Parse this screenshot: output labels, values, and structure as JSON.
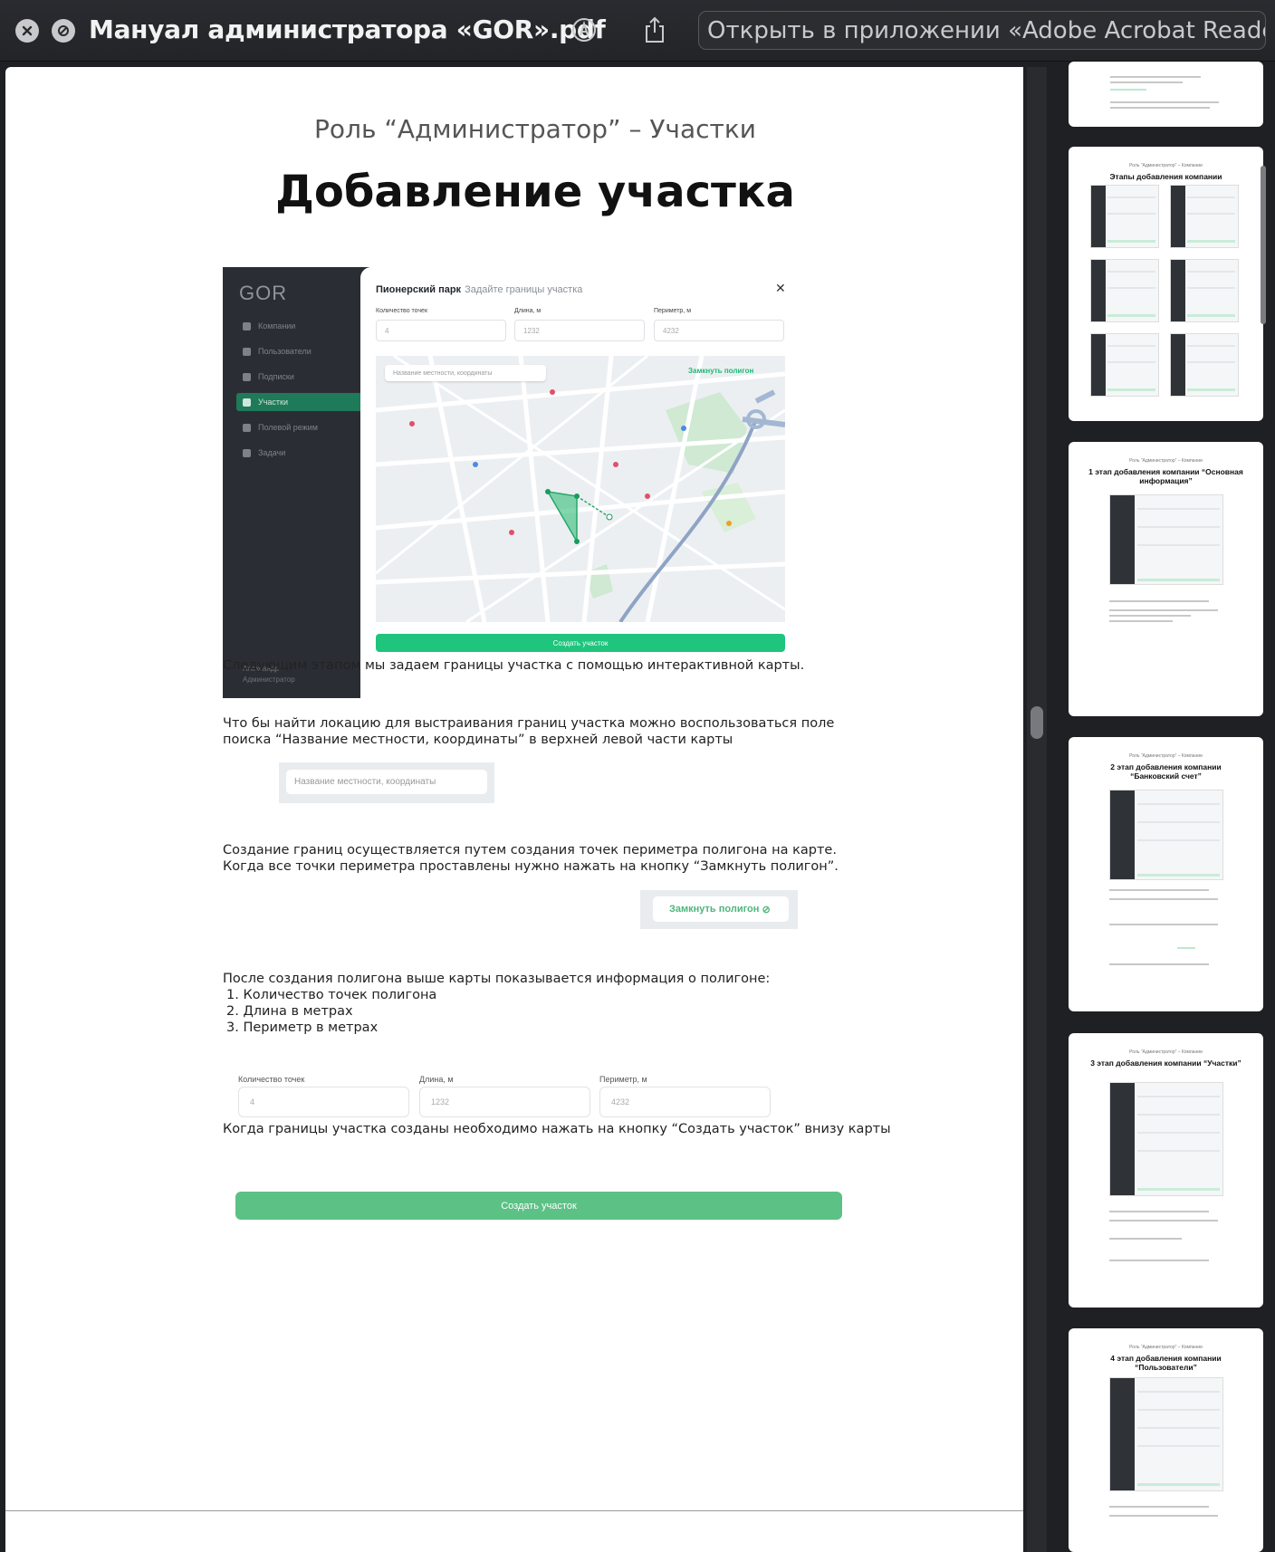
{
  "topbar": {
    "title": "Мануал администратора «GOR».pdf",
    "open_in_app": "Открыть в приложении «Adobe Acrobat Reader»",
    "icons": [
      "close-icon",
      "no-entry-icon",
      "markup-icon",
      "share-icon"
    ]
  },
  "doc": {
    "subtitle": "Роль “Администратор” – Участки",
    "title": "Добавление участка",
    "app": {
      "logo": "GOR",
      "menu": [
        "Компании",
        "Пользователи",
        "Подписки",
        "Участки",
        "Полевой режим",
        "Задачи"
      ],
      "active_menu": "Участки",
      "user_name": "Александр",
      "user_role": "Администратор",
      "dialog_title": "Пионерский парк",
      "dialog_subtitle": "Задайте границы участка",
      "fields": [
        {
          "label": "Количество точек",
          "value": "4"
        },
        {
          "label": "Длина, м",
          "value": "1232"
        },
        {
          "label": "Периметр, м",
          "value": "4232"
        }
      ],
      "map_search_placeholder": "Название местности, координаты",
      "close_polygon": "Замкнуть полигон",
      "create_button": "Создать участок"
    },
    "p1": "Следующим этапом мы задаем границы участка с помощью интерактивной карты.",
    "p2": "Что бы найти локацию для выстраивания границ участка можно воспользоваться поле поиска “Название местности, координаты” в верхней левой части карты",
    "search_example": "Название местности, координаты",
    "p3": "Создание границ осуществляется путем создания точек периметра полигона на карте. Когда все точки периметра проставлены нужно нажать на кнопку “Замкнуть полигон”.",
    "close_polygon_example": "Замкнуть полигон",
    "p4": "После создания полигона выше карты показывается информация о полигоне:",
    "list": [
      "1. Количество точек полигона",
      "2. Длина в метрах",
      "3. Периметр в метрах"
    ],
    "info_fields": [
      {
        "label": "Количество точек",
        "value": "4"
      },
      {
        "label": "Длина, м",
        "value": "1232"
      },
      {
        "label": "Периметр, м",
        "value": "4232"
      }
    ],
    "p5": "Когда границы участка созданы необходимо нажать на кнопку “Создать участок” внизу карты",
    "create_button": "Создать участок"
  },
  "thumbnails": [
    {
      "subtitle": "",
      "title": ""
    },
    {
      "subtitle": "Роль “Администратор” – Компании",
      "title": "Этапы добавления компании"
    },
    {
      "subtitle": "Роль “Администратор” – Компании",
      "title": "1 этап добавления компании “Основная информация”"
    },
    {
      "subtitle": "Роль “Администратор” – Компании",
      "title": "2 этап добавления компании “Банковский счет”"
    },
    {
      "subtitle": "Роль “Администратор” – Компании",
      "title": "3 этап добавления компании “Участки”"
    },
    {
      "subtitle": "Роль “Администратор” – Компании",
      "title": "4 этап добавления компании “Пользователи”"
    }
  ],
  "colors": {
    "accent": "#1fc47d",
    "sidebar": "#2a2e34",
    "topbar": "#232428"
  }
}
